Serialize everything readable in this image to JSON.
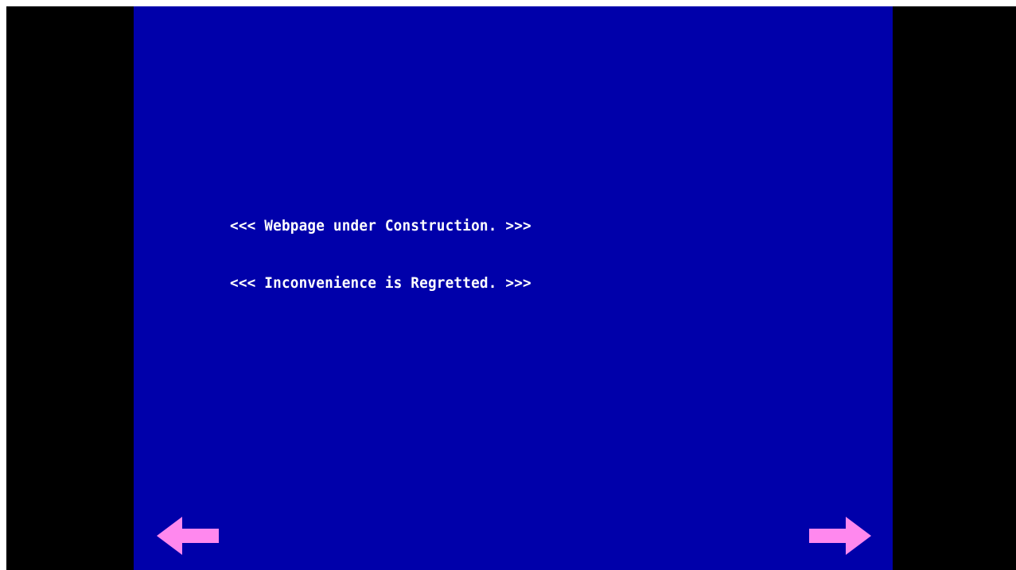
{
  "screen": {
    "background_color": "#0000aa",
    "outer_color": "#000000",
    "text_color": "#ffffff"
  },
  "message": {
    "lines": [
      "<<< Webpage under Construction. >>>",
      "<<< Inconvenience is Regretted. >>>"
    ]
  },
  "navigation": {
    "prev_icon": "arrow-left-icon",
    "next_icon": "arrow-right-icon",
    "arrow_color": "#ff88ee"
  }
}
